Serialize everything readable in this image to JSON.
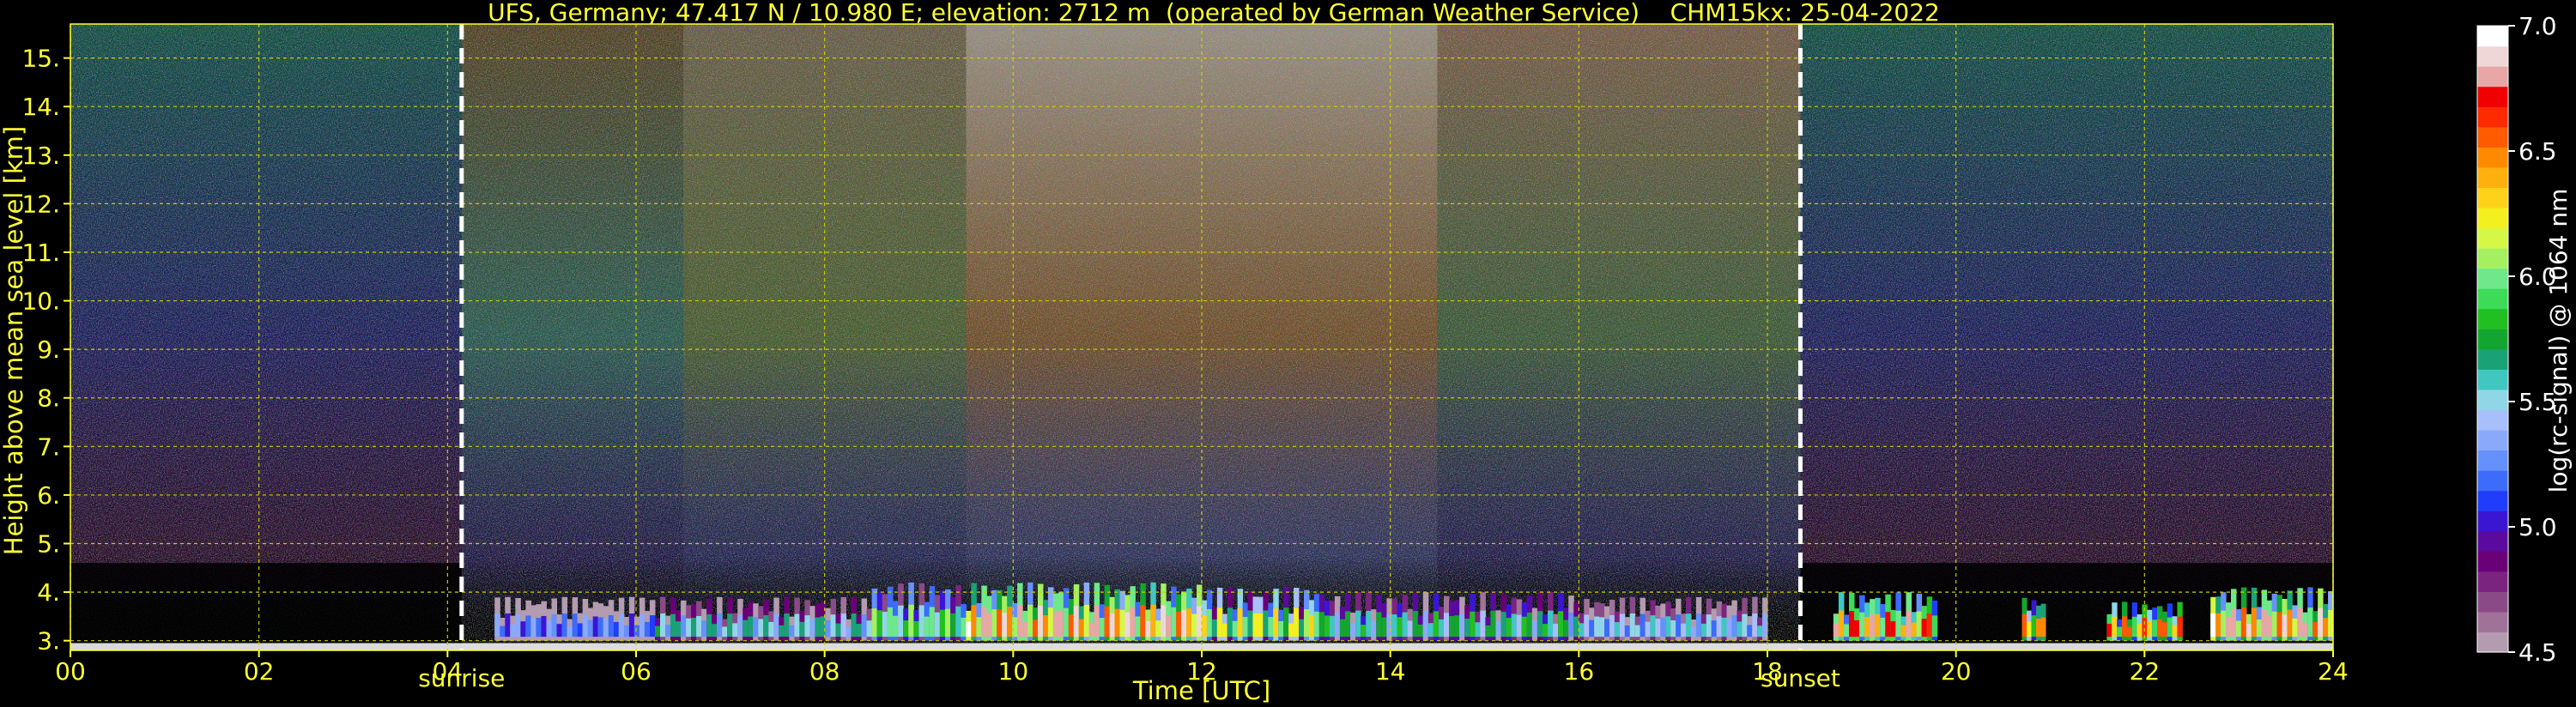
{
  "title": "UFS, Germany; 47.417 N / 10.980 E; elevation: 2712 m  (operated by German Weather Service)    CHM15kx: 25-04-2022",
  "colors": {
    "axis_text": "#ffff33",
    "grid": "#cccc00",
    "background": "#000000",
    "marker_line": "#ffffff"
  },
  "chart_data": {
    "type": "heatmap",
    "title": "UFS, Germany; 47.417 N / 10.980 E; elevation: 2712 m  (operated by German Weather Service)    CHM15kx: 25-04-2022",
    "xlabel": "Time [UTC]",
    "ylabel": "Height above mean sea level [km]",
    "xlim": [
      0,
      24
    ],
    "ylim": [
      2.8,
      15.7
    ],
    "x_ticks": [
      "00",
      "02",
      "04",
      "06",
      "08",
      "10",
      "12",
      "14",
      "16",
      "18",
      "20",
      "22",
      "24"
    ],
    "y_ticks": [
      "3.",
      "4.",
      "5.",
      "6.",
      "7.",
      "8.",
      "9.",
      "10.",
      "11.",
      "12.",
      "13.",
      "14.",
      "15."
    ],
    "grid": true,
    "annotations": [
      {
        "label": "sunrise",
        "x": 4.15
      },
      {
        "label": "sunset",
        "x": 18.35
      }
    ],
    "colorbar": {
      "label": "log(rc-signal) @ 1064 nm",
      "range": [
        4.5,
        7.0
      ],
      "ticks": [
        "4.5",
        "5.0",
        "5.5",
        "6.0",
        "6.5",
        "7.0"
      ],
      "colors": [
        "#b39bb0",
        "#a0729a",
        "#8a4a87",
        "#7a2480",
        "#6a0077",
        "#5a0a9c",
        "#3a16d3",
        "#1f3dfa",
        "#3d6bfb",
        "#6690fb",
        "#8aa9fb",
        "#a7bffa",
        "#91d6e6",
        "#3fc7c0",
        "#1aa276",
        "#14a530",
        "#22bf22",
        "#3cdb58",
        "#6ee88a",
        "#a4f060",
        "#d4f845",
        "#f4f020",
        "#ffd21a",
        "#ffb00f",
        "#ff8a00",
        "#ff5a00",
        "#ff2a00",
        "#f00000",
        "#e8a6a6",
        "#f0d7d7",
        "#ffffff"
      ]
    },
    "cloud_events": [
      {
        "x_start": 4.5,
        "x_end": 6.2,
        "y_top": 3.9,
        "intensity": 0.35
      },
      {
        "x_start": 6.2,
        "x_end": 8.5,
        "y_top": 3.9,
        "intensity": 0.5
      },
      {
        "x_start": 8.5,
        "x_end": 9.5,
        "y_top": 4.2,
        "intensity": 0.65
      },
      {
        "x_start": 9.5,
        "x_end": 12.0,
        "y_top": 4.2,
        "intensity": 1.0
      },
      {
        "x_start": 12.0,
        "x_end": 13.3,
        "y_top": 4.1,
        "intensity": 0.75
      },
      {
        "x_start": 13.3,
        "x_end": 16.0,
        "y_top": 4.0,
        "intensity": 0.55
      },
      {
        "x_start": 16.0,
        "x_end": 18.0,
        "y_top": 3.9,
        "intensity": 0.45
      },
      {
        "x_start": 18.7,
        "x_end": 19.8,
        "y_top": 4.0,
        "intensity": 0.95
      },
      {
        "x_start": 20.7,
        "x_end": 20.95,
        "y_top": 3.9,
        "intensity": 0.85
      },
      {
        "x_start": 21.6,
        "x_end": 22.4,
        "y_top": 3.8,
        "intensity": 0.9
      },
      {
        "x_start": 22.7,
        "x_end": 24.0,
        "y_top": 4.1,
        "intensity": 1.0
      }
    ]
  }
}
